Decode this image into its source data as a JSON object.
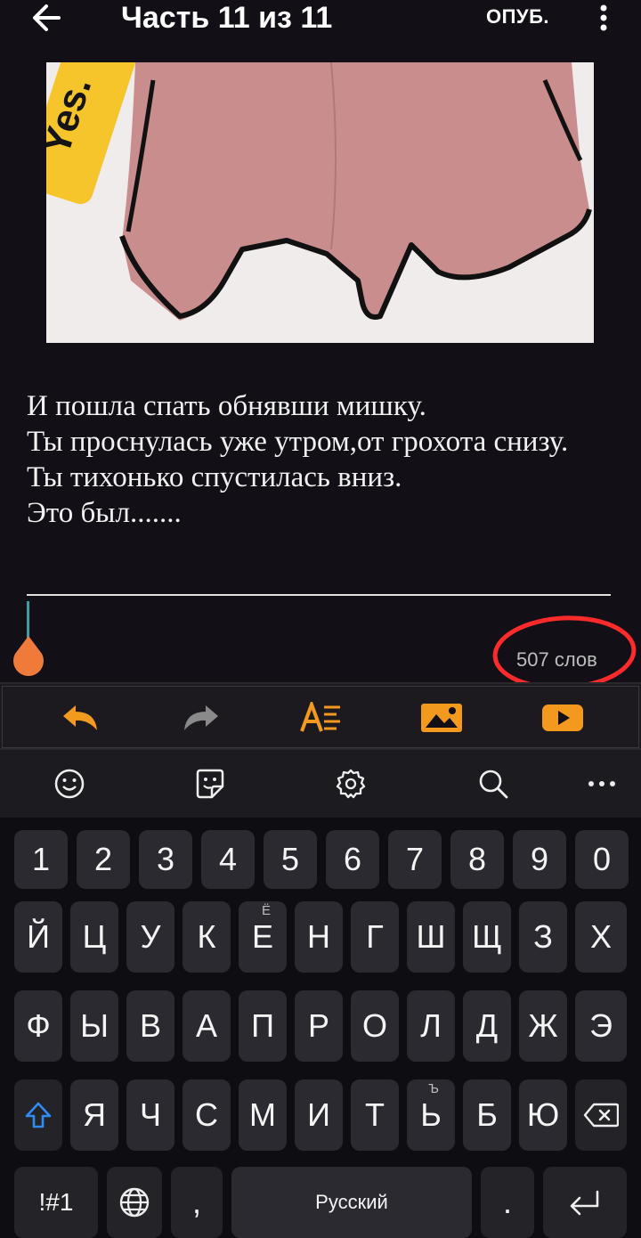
{
  "header": {
    "title": "Часть 11 из 11",
    "publish_label": "ОПУБ."
  },
  "photo": {
    "phone_text": "Yes."
  },
  "story": {
    "lines": [
      "И пошла спать обнявши мишку.",
      "Ты проснулась уже утром,от грохота снизу.",
      "Ты тихонько спустилась вниз.",
      "Это был......."
    ]
  },
  "word_count": "507 слов",
  "colors": {
    "accent_orange": "#f39a1e",
    "annotation_red": "#ff2a2a",
    "cursor_teal": "#3aa0a3",
    "shift_blue": "#2f8df5"
  },
  "toolbar": {
    "icons": [
      "undo-icon",
      "redo-icon",
      "text-format-icon",
      "insert-image-icon",
      "insert-video-icon"
    ]
  },
  "keyboard": {
    "top_icons": [
      "emoji-icon",
      "sticker-icon",
      "settings-icon",
      "search-icon",
      "more-icon"
    ],
    "row_numbers": [
      "1",
      "2",
      "3",
      "4",
      "5",
      "6",
      "7",
      "8",
      "9",
      "0"
    ],
    "row1": [
      "Й",
      "Ц",
      "У",
      "К",
      "Е",
      "Н",
      "Г",
      "Ш",
      "Щ",
      "З",
      "Х"
    ],
    "row1_sub": {
      "4": "Ё"
    },
    "row2": [
      "Ф",
      "Ы",
      "В",
      "А",
      "П",
      "Р",
      "О",
      "Л",
      "Д",
      "Ж",
      "Э"
    ],
    "row3": [
      "Я",
      "Ч",
      "С",
      "М",
      "И",
      "Т",
      "Ь",
      "Б",
      "Ю"
    ],
    "row3_sub": {
      "6": "Ъ"
    },
    "bottom": {
      "symbols": "!#1",
      "comma": ",",
      "space": "Русский",
      "period": "."
    }
  }
}
